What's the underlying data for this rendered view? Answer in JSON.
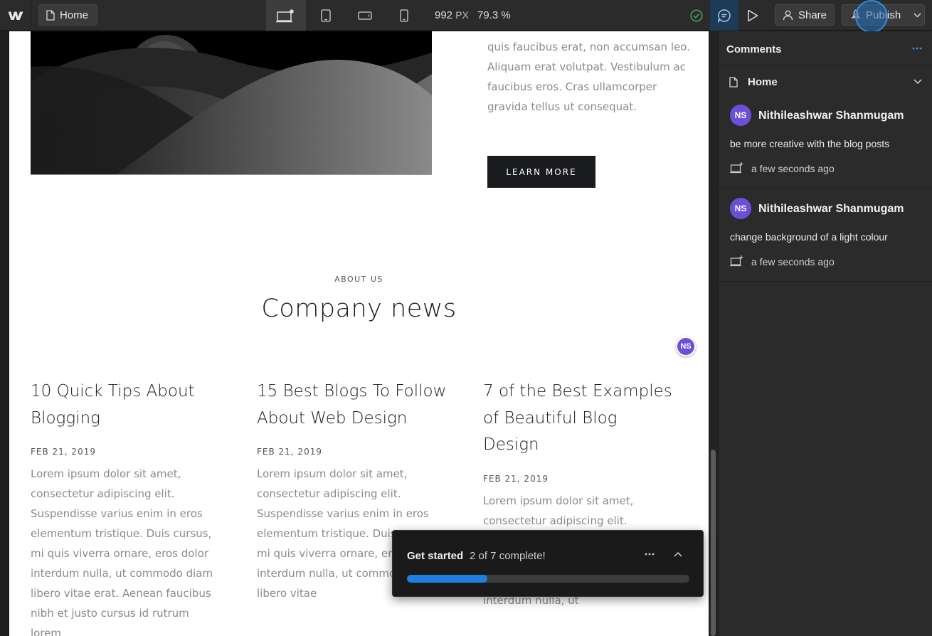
{
  "topbar": {
    "page_label": "Home",
    "viewport_width": "992",
    "viewport_unit": "PX",
    "zoom": "79.3 %",
    "share_label": "Share",
    "publish_label": "Publish",
    "devices": [
      "desktop-icon",
      "tablet-icon",
      "mobile-landscape-icon",
      "mobile-portrait-icon"
    ]
  },
  "canvas": {
    "hero_text": "quis faucibus erat, non accumsan leo. Aliquam erat volutpat. Vestibulum ac faucibus eros. Cras ullamcorper gravida tellus ut consequat.",
    "learn_more": "LEARN MORE",
    "eyebrow": "ABOUT US",
    "section_title": "Company news",
    "comment_marker": "NS",
    "posts": [
      {
        "title": "10 Quick Tips About Blogging",
        "date": "FEB 21, 2019",
        "body": "Lorem ipsum dolor sit amet, consectetur adipiscing elit. Suspendisse varius enim in eros elementum tristique. Duis cursus, mi quis viverra ornare, eros dolor interdum nulla, ut commodo diam libero vitae erat. Aenean faucibus nibh et justo cursus id rutrum lorem"
      },
      {
        "title": "15 Best Blogs To Follow About Web Design",
        "date": "FEB 21, 2019",
        "body": "Lorem ipsum dolor sit amet, consectetur adipiscing elit. Suspendisse varius enim in eros elementum tristique. Duis cursus, mi quis viverra ornare, eros dolor interdum nulla, ut commodo diam libero vitae"
      },
      {
        "title": "7 of the Best Examples of Beautiful Blog Design",
        "date": "FEB 21, 2019",
        "body": "Lorem ipsum dolor sit amet, consectetur adipiscing elit. Suspendisse varius enim in eros elementum tristique. Duis cursus, mi quis viverra ornare, eros dolor interdum nulla, ut"
      }
    ]
  },
  "get_started": {
    "title": "Get started",
    "progress_text": "2 of 7 complete!",
    "progress_fraction": 0.2857
  },
  "comments_panel": {
    "title": "Comments",
    "page_name": "Home",
    "comments": [
      {
        "initials": "NS",
        "author": "Nithileashwar Shanmugam",
        "text": "be more creative with the blog posts",
        "time": "a few seconds ago"
      },
      {
        "initials": "NS",
        "author": "Nithileashwar Shanmugam",
        "text": "change background of a light colour",
        "time": "a few seconds ago"
      }
    ]
  },
  "colors": {
    "accent_blue": "#1f7fe0",
    "avatar_purple": "#6c4fd8",
    "status_green": "#3fae5a"
  }
}
